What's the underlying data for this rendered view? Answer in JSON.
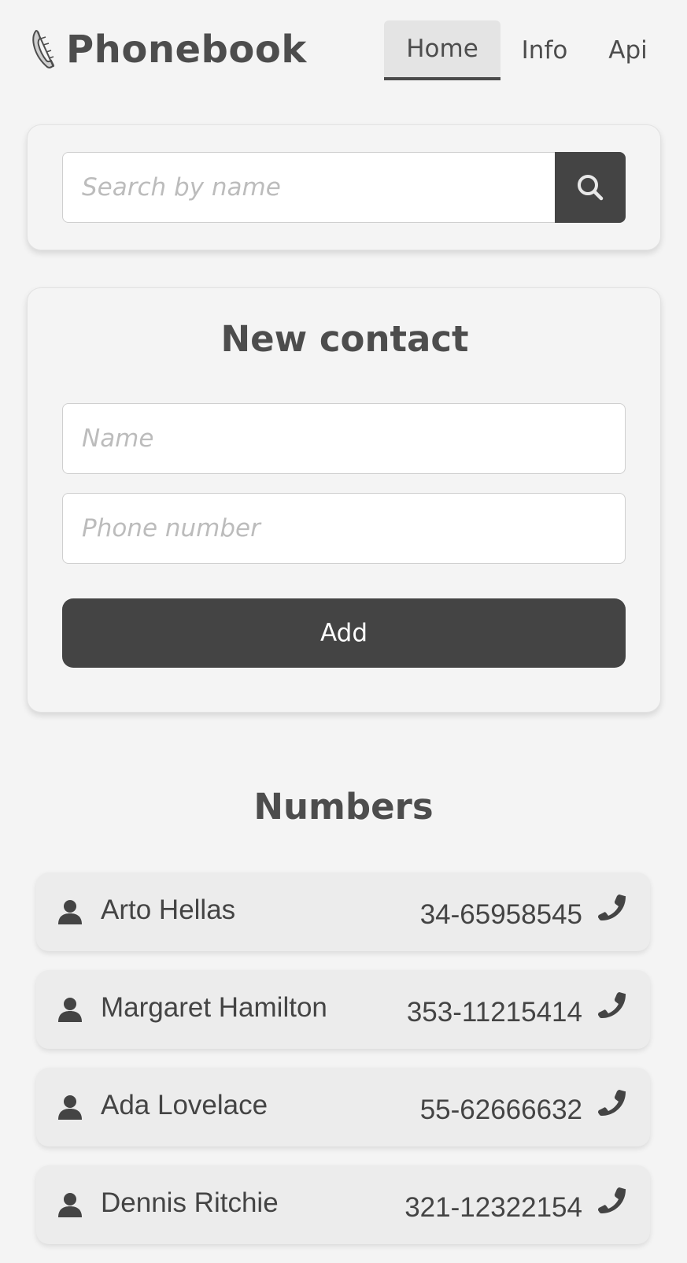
{
  "header": {
    "app_title": "Phonebook",
    "logo_icon": "feather-phone-icon",
    "nav": [
      {
        "label": "Home",
        "active": true
      },
      {
        "label": "Info",
        "active": false
      },
      {
        "label": "Api",
        "active": false
      }
    ]
  },
  "search": {
    "placeholder": "Search by name",
    "value": "",
    "button_icon": "search-icon"
  },
  "new_contact": {
    "title": "New contact",
    "name_placeholder": "Name",
    "phone_placeholder": "Phone number",
    "add_label": "Add"
  },
  "numbers": {
    "title": "Numbers",
    "contacts": [
      {
        "name": "Arto Hellas",
        "number": "34-65958545"
      },
      {
        "name": "Margaret Hamilton",
        "number": "353-11215414"
      },
      {
        "name": "Ada Lovelace",
        "number": "55-62666632"
      },
      {
        "name": "Dennis Ritchie",
        "number": "321-12322154"
      }
    ]
  },
  "colors": {
    "background": "#f4f4f4",
    "dark_button": "#444444",
    "text": "#4d4d4d",
    "placeholder": "#bcbcbc",
    "row_background": "#ececec"
  }
}
